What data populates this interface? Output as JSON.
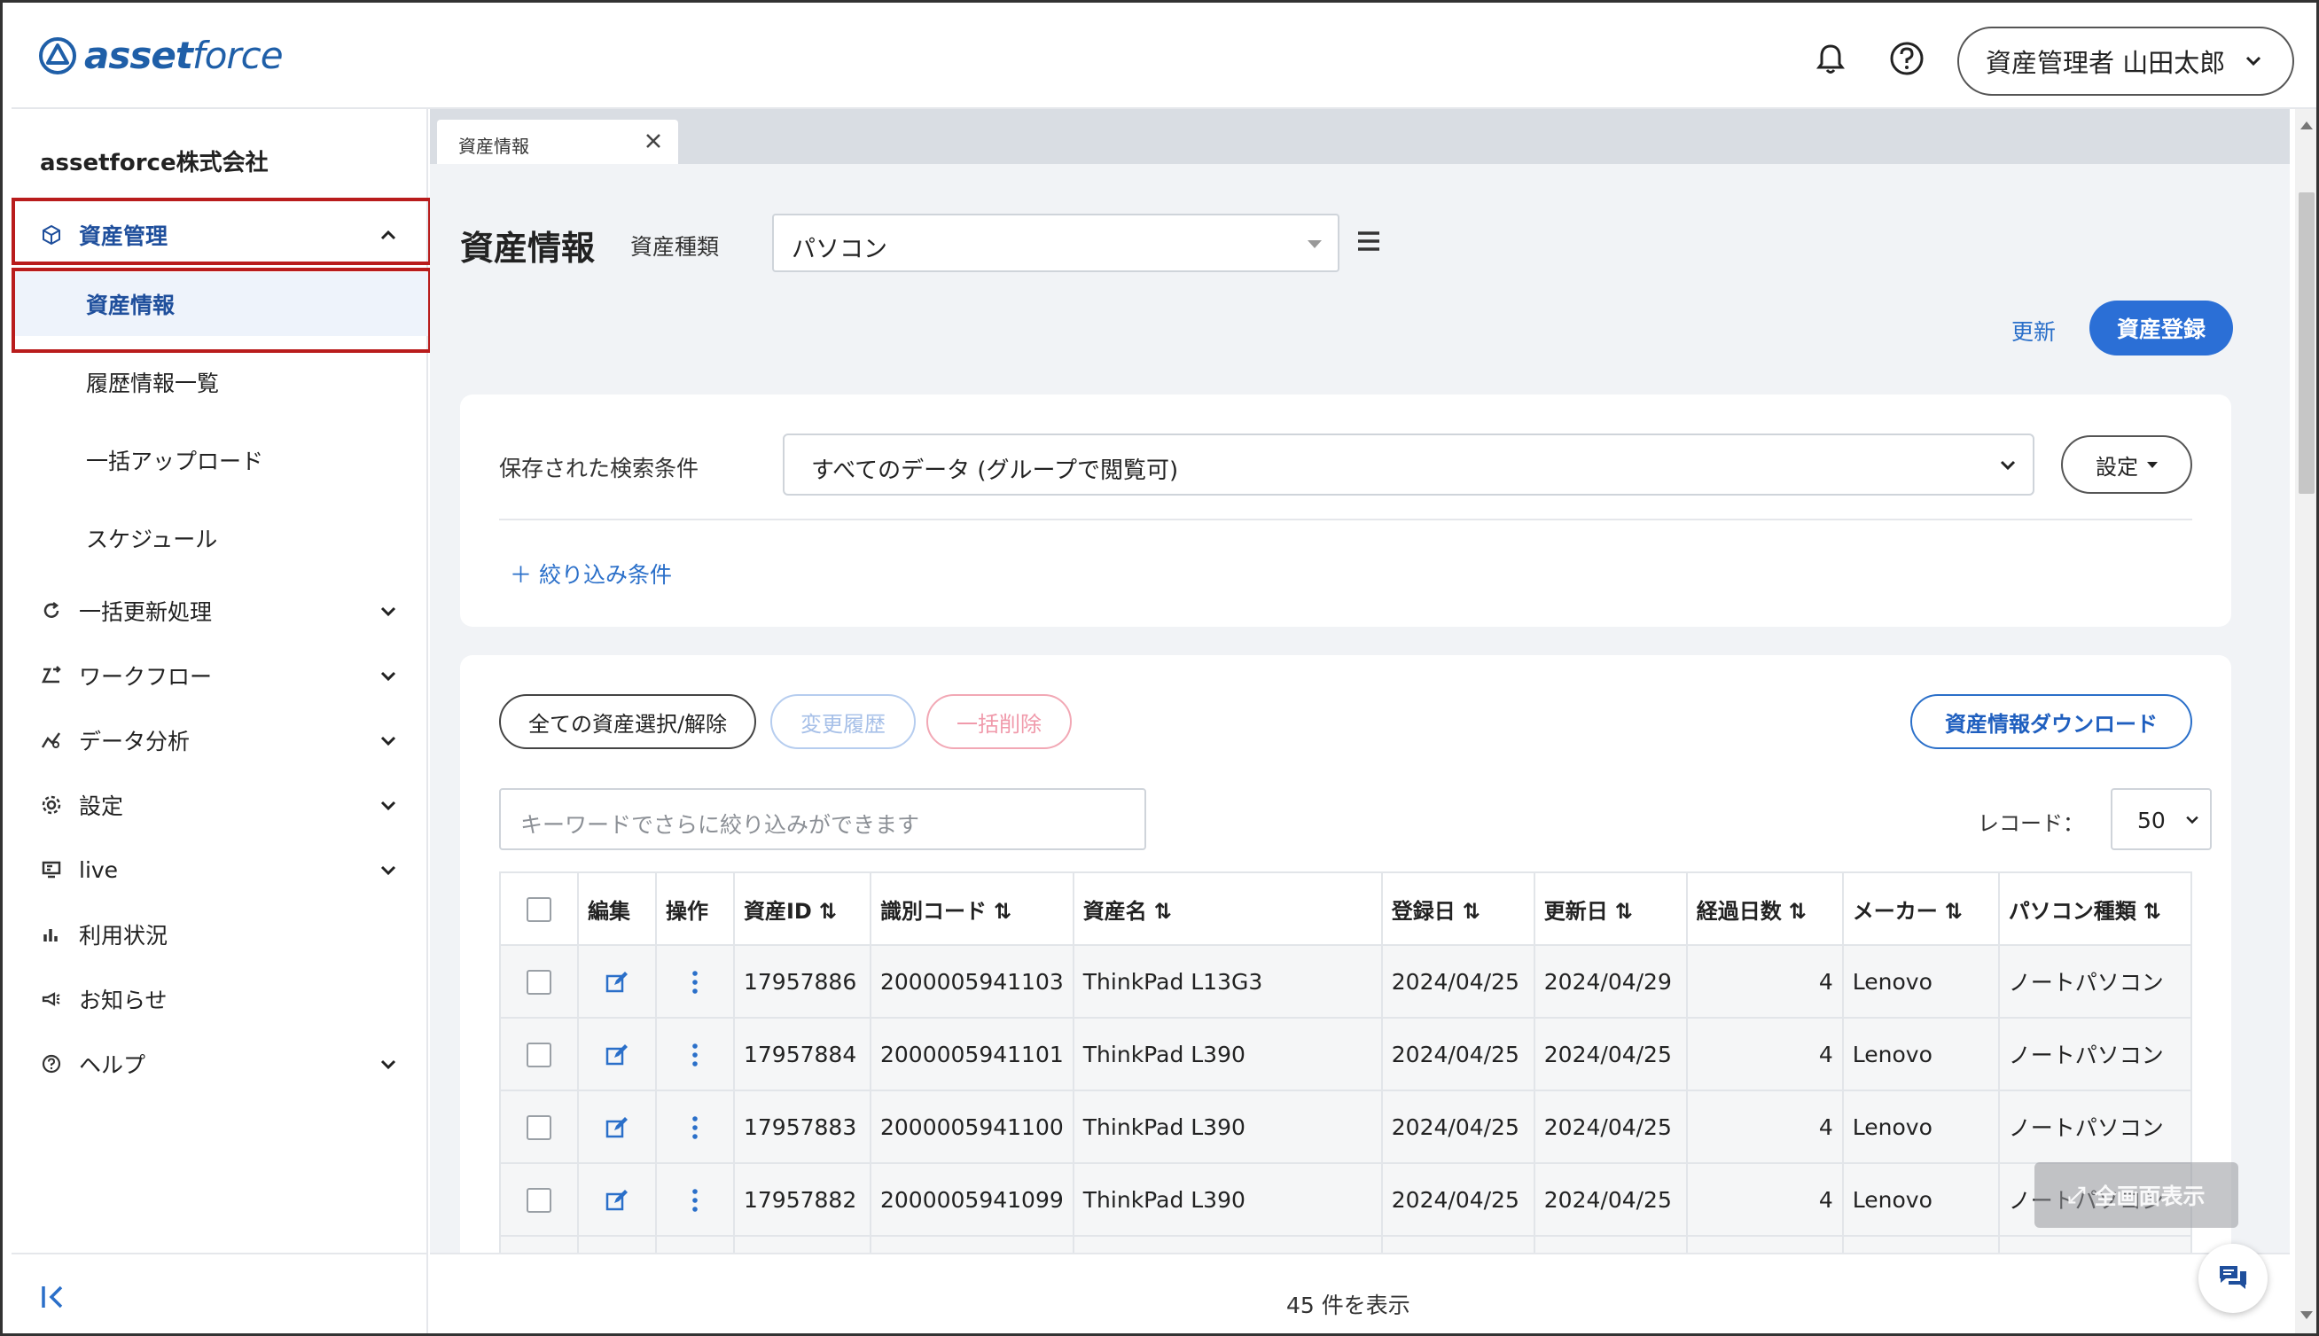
{
  "app": {
    "logo_text_bold": "asset",
    "logo_text_light": "force",
    "user_label": "資産管理者 山田太郎"
  },
  "sidebar": {
    "company": "assetforce株式会社",
    "items": [
      {
        "label": "資産管理",
        "icon": "cube-icon",
        "expanded": true
      },
      {
        "label": "資産情報",
        "sub": true,
        "active": true
      },
      {
        "label": "履歴情報一覧",
        "sub": true
      },
      {
        "label": "一括アップロード",
        "sub": true
      },
      {
        "label": "スケジュール",
        "sub": true
      },
      {
        "label": "一括更新処理",
        "icon": "refresh-icon"
      },
      {
        "label": "ワークフロー",
        "icon": "workflow-icon"
      },
      {
        "label": "データ分析",
        "icon": "analytics-icon"
      },
      {
        "label": "設定",
        "icon": "gear-icon"
      },
      {
        "label": "live",
        "icon": "live-icon"
      },
      {
        "label": "利用状況",
        "icon": "bar-chart-icon"
      },
      {
        "label": "お知らせ",
        "icon": "megaphone-icon"
      },
      {
        "label": "ヘルプ",
        "icon": "help-icon"
      }
    ]
  },
  "tabs": [
    {
      "label": "資産情報"
    }
  ],
  "page": {
    "title": "資産情報",
    "type_label": "資産種類",
    "type_value": "パソコン",
    "refresh_label": "更新",
    "register_label": "資産登録"
  },
  "search": {
    "saved_label": "保存された検索条件",
    "saved_value": "すべてのデータ (グループで閲覧可)",
    "settings_label": "設定",
    "filter_label": "絞り込み条件"
  },
  "toolbar": {
    "select_all": "全ての資産選択/解除",
    "history": "変更履歴",
    "bulk_delete": "一括削除",
    "download": "資産情報ダウンロード",
    "keyword_placeholder": "キーワードでさらに絞り込みができます",
    "record_label": "レコード：",
    "record_value": "50"
  },
  "table": {
    "headers": [
      "編集",
      "操作",
      "資産ID",
      "識別コード",
      "資産名",
      "登録日",
      "更新日",
      "経過日数",
      "メーカー",
      "パソコン種類"
    ],
    "rows": [
      {
        "id": "17957886",
        "code": "2000005941103",
        "name": "ThinkPad L13G3",
        "reg": "2024/04/25",
        "upd": "2024/04/29",
        "days": "4",
        "maker": "Lenovo",
        "kind": "ノートパソコン"
      },
      {
        "id": "17957884",
        "code": "2000005941101",
        "name": "ThinkPad L390",
        "reg": "2024/04/25",
        "upd": "2024/04/25",
        "days": "4",
        "maker": "Lenovo",
        "kind": "ノートパソコン"
      },
      {
        "id": "17957883",
        "code": "2000005941100",
        "name": "ThinkPad L390",
        "reg": "2024/04/25",
        "upd": "2024/04/25",
        "days": "4",
        "maker": "Lenovo",
        "kind": "ノートパソコン"
      },
      {
        "id": "17957882",
        "code": "2000005941099",
        "name": "ThinkPad L390",
        "reg": "2024/04/25",
        "upd": "2024/04/25",
        "days": "4",
        "maker": "Lenovo",
        "kind": "ノートパソコン"
      }
    ]
  },
  "footer": {
    "count": "45 件を表示",
    "fullscreen": "全画面表示"
  },
  "colors": {
    "primary": "#2b6fd6",
    "link": "#2a6fc9",
    "highlight_border": "#b91c1c",
    "nav_active": "#1f4f9c"
  }
}
